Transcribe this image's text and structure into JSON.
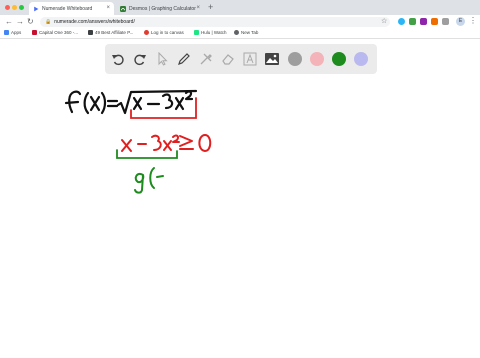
{
  "browser": {
    "tabs": [
      {
        "title": "Numerade Whiteboard",
        "active": true,
        "favicon": "play-triangle-icon"
      },
      {
        "title": "Desmos | Graphing Calculator",
        "active": false,
        "favicon": "desmos-icon"
      }
    ],
    "new_tab_symbol": "+",
    "close_symbol": "×",
    "url": "numerade.com/answers/whiteboard/",
    "avatar_letter": "E"
  },
  "bookmarks": [
    {
      "label": "Apps",
      "icon": "apps-grid-icon",
      "color": "#4285f4"
    },
    {
      "label": "Capital One 360 -...",
      "icon": "capital-one-icon",
      "color": "#c8102e"
    },
    {
      "label": "49 Best Affiliate P...",
      "icon": "bookmark-page-icon",
      "color": "#3c4043"
    },
    {
      "label": "Log in to canvas",
      "icon": "canvas-icon",
      "color": "#e03c31"
    },
    {
      "label": "Hulu | Watch",
      "icon": "hulu-icon",
      "color": "#1ce783"
    },
    {
      "label": "New Tab",
      "icon": "globe-icon",
      "color": "#5f6368"
    }
  ],
  "whiteboard": {
    "tools": [
      "undo-icon",
      "redo-icon",
      "select-cursor-icon",
      "pen-icon",
      "tools-icon",
      "eraser-icon",
      "text-tool-icon",
      "image-icon"
    ],
    "colors": [
      "#9e9e9e",
      "#f3b3b8",
      "#1e8b1e",
      "#b9b9ef"
    ],
    "selected_color": "#1e8b1e",
    "ink_colors": {
      "black": "#111111",
      "red": "#e02020",
      "green": "#1e8b1e"
    }
  }
}
